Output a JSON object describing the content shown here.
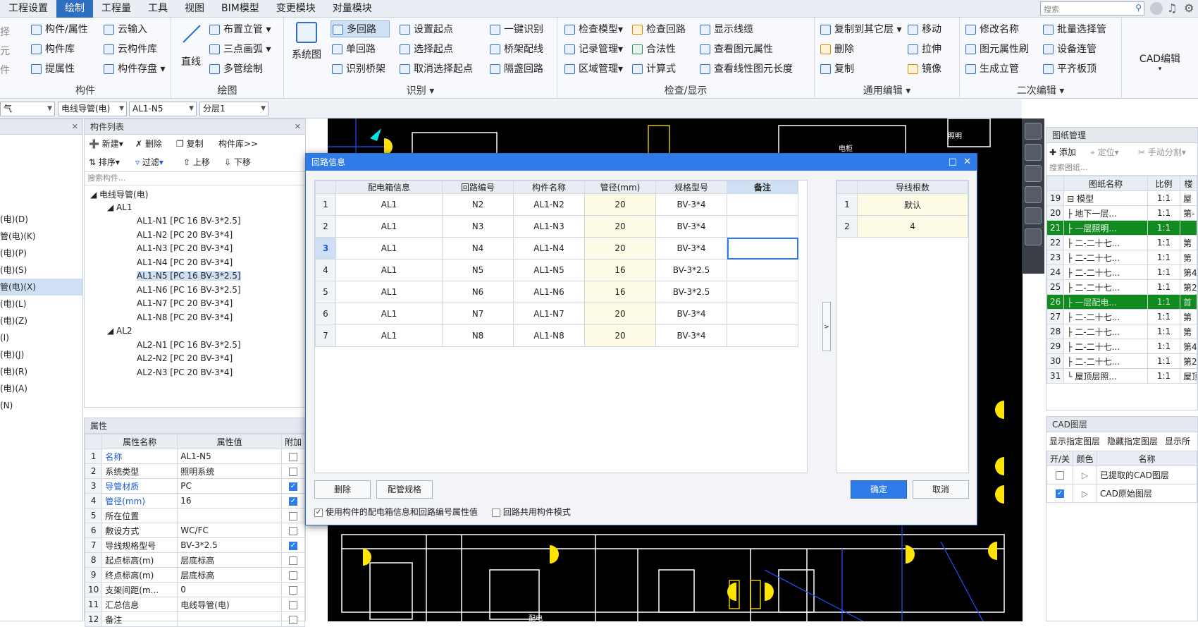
{
  "menu": [
    "工程设置",
    "绘制",
    "工程量",
    "工具",
    "视图",
    "BIM模型",
    "变更模块",
    "对量模块"
  ],
  "menu_active": 1,
  "search_placeholder": "搜索",
  "ribbon": {
    "g1": {
      "b1": "构件/属性",
      "b2": "构件库",
      "b3": "提属性",
      "b4": "云输入",
      "b5": "云构件库",
      "b6": "构件存盘",
      "label": "构件",
      "left_clip": [
        "择",
        "元",
        "件"
      ]
    },
    "g2": {
      "big": "直线",
      "b1": "布置立管",
      "b2": "三点画弧",
      "b3": "多管绘制",
      "label": "绘图"
    },
    "g3": {
      "big": "系统图",
      "b1": "多回路",
      "b2": "单回路",
      "b3": "识别桥架",
      "b4": "设置起点",
      "b5": "选择起点",
      "b6": "取消选择起点",
      "b7": "一键识别",
      "b8": "桥架配线",
      "b9": "隔盏回路",
      "label": "识别"
    },
    "g4": {
      "b1": "检查模型",
      "b2": "记录管理",
      "b3": "区域管理",
      "b4": "检查回路",
      "b5": "合法性",
      "b6": "计算式",
      "b7": "显示线缆",
      "b8": "查看图元属性",
      "b9": "查看线性图元长度",
      "label": "检查/显示"
    },
    "g5": {
      "b1": "复制到其它层",
      "b2": "删除",
      "b3": "复制",
      "b4": "移动",
      "b5": "拉伸",
      "b6": "镜像",
      "label": "通用编辑"
    },
    "g6": {
      "b1": "修改名称",
      "b2": "图元属性刷",
      "b3": "生成立管",
      "b4": "批量选择管",
      "b5": "设备连管",
      "b6": "平齐板顶",
      "label": "二次编辑"
    },
    "g7": {
      "big": "CAD编辑"
    }
  },
  "combos": [
    "气",
    "电线导管(电)",
    "AL1-N5",
    "分层1"
  ],
  "leftClip": [
    "(电)(D)",
    "管(电)(K)",
    "(电)(P)",
    "(电)(S)",
    "管(电)(X)",
    "(电)(L)",
    "(电)(Z)",
    "(I)",
    "(电)(J)",
    "(电)(R)",
    "(电)(A)",
    "(N)"
  ],
  "complist": {
    "title": "构件列表",
    "tb": [
      "新建",
      "删除",
      "复制",
      "构件库>>",
      "排序",
      "过滤",
      "上移",
      "下移"
    ],
    "search": "搜索构件...",
    "root": "电线导管(电)",
    "g1": "AL1",
    "g1items": [
      "AL1-N1 [PC 16 BV-3*2.5]",
      "AL1-N2 [PC 20 BV-3*4]",
      "AL1-N3 [PC 20 BV-3*4]",
      "AL1-N4 [PC 20 BV-3*4]",
      "AL1-N5 [PC 16 BV-3*2.5]",
      "AL1-N6 [PC 16 BV-3*2.5]",
      "AL1-N7 [PC 20 BV-3*4]",
      "AL1-N8 [PC 20 BV-3*4]"
    ],
    "g2": "AL2",
    "g2items": [
      "AL2-N1 [PC 16 BV-3*2.5]",
      "AL2-N2 [PC 20 BV-3*4]",
      "AL2-N3 [PC 20 BV-3*4]"
    ]
  },
  "props": {
    "title": "属性",
    "headers": [
      "属性名称",
      "属性值",
      "附加"
    ],
    "rows": [
      [
        "1",
        "名称",
        "AL1-N5",
        false,
        true
      ],
      [
        "2",
        "系统类型",
        "照明系统",
        false,
        false
      ],
      [
        "3",
        "导管材质",
        "PC",
        true,
        true
      ],
      [
        "4",
        "管径(mm)",
        "16",
        true,
        true
      ],
      [
        "5",
        "所在位置",
        "",
        false,
        false
      ],
      [
        "6",
        "敷设方式",
        "WC/FC",
        false,
        false
      ],
      [
        "7",
        "导线规格型号",
        "BV-3*2.5",
        true,
        false
      ],
      [
        "8",
        "起点标高(m)",
        "层底标高",
        false,
        false
      ],
      [
        "9",
        "终点标高(m)",
        "层底标高",
        false,
        false
      ],
      [
        "10",
        "支架间距(m...",
        "0",
        false,
        false
      ],
      [
        "11",
        "汇总信息",
        "电线导管(电)",
        false,
        false
      ],
      [
        "12",
        "备注",
        "",
        false,
        false
      ]
    ]
  },
  "dialog": {
    "title": "回路信息",
    "headers": [
      "配电箱信息",
      "回路编号",
      "构件名称",
      "管径(mm)",
      "规格型号",
      "备注"
    ],
    "rows": [
      [
        "1",
        "AL1",
        "N2",
        "AL1-N2",
        "20",
        "BV-3*4",
        ""
      ],
      [
        "2",
        "AL1",
        "N3",
        "AL1-N3",
        "20",
        "BV-3*4",
        ""
      ],
      [
        "3",
        "AL1",
        "N4",
        "AL1-N4",
        "20",
        "BV-3*4",
        ""
      ],
      [
        "4",
        "AL1",
        "N5",
        "AL1-N5",
        "16",
        "BV-3*2.5",
        ""
      ],
      [
        "5",
        "AL1",
        "N6",
        "AL1-N6",
        "16",
        "BV-3*2.5",
        ""
      ],
      [
        "6",
        "AL1",
        "N7",
        "AL1-N7",
        "20",
        "BV-3*4",
        ""
      ],
      [
        "7",
        "AL1",
        "N8",
        "AL1-N8",
        "20",
        "BV-3*4",
        ""
      ]
    ],
    "wire_header": "导线根数",
    "wire_rows": [
      [
        "1",
        "默认"
      ],
      [
        "2",
        "4"
      ]
    ],
    "btn_delete": "删除",
    "btn_spec": "配管规格",
    "btn_ok": "确定",
    "btn_cancel": "取消",
    "chk1": "使用构件的配电箱信息和回路编号属性值",
    "chk2": "回路共用构件模式"
  },
  "drawings": {
    "title": "图纸管理",
    "tb": [
      "添加",
      "定位",
      "手动分割"
    ],
    "search": "搜索图纸...",
    "headers": [
      "",
      "图纸名称",
      "比例",
      "楼"
    ],
    "rows": [
      [
        "19",
        "⊟ 模型",
        "1:1",
        "屋",
        "n"
      ],
      [
        "20",
        "├ 地下一层...",
        "1:1",
        "第-",
        "n"
      ],
      [
        "21",
        "├ 一层照明...",
        "1:1",
        "",
        "s"
      ],
      [
        "22",
        "├ 二-二十七...",
        "1:1",
        "第",
        "n"
      ],
      [
        "23",
        "├ 二-二十七...",
        "1:1",
        "第",
        "n"
      ],
      [
        "24",
        "├ 二-二十七...",
        "1:1",
        "第4~",
        "n"
      ],
      [
        "25",
        "├ 二-二十七...",
        "1:1",
        "第2",
        "n"
      ],
      [
        "26",
        "├ 一层配电...",
        "1:1",
        "首",
        "g"
      ],
      [
        "27",
        "├ 二-二十七...",
        "1:1",
        "第",
        "n"
      ],
      [
        "28",
        "├ 二-二十七...",
        "1:1",
        "第",
        "n"
      ],
      [
        "29",
        "├ 二-二十七...",
        "1:1",
        "第4~",
        "n"
      ],
      [
        "30",
        "├ 二-二十七...",
        "1:1",
        "第2",
        "n"
      ],
      [
        "31",
        "└ 屋顶层照...",
        "1:1",
        "屋顶",
        "n"
      ]
    ]
  },
  "cadlayers": {
    "title": "CAD图层",
    "tb": [
      "显示指定图层",
      "隐藏指定图层",
      "显示所"
    ],
    "headers": [
      "开/关",
      "颜色",
      "名称"
    ],
    "rows": [
      [
        "已提取的CAD图层",
        false
      ],
      [
        "CAD原始图层",
        true
      ]
    ]
  },
  "canvas_texts": [
    "照明",
    "配电",
    "电柜"
  ],
  "colors": {
    "accent": "#2f7be8",
    "green_row": "#118a1f",
    "cad_bg": "#000000",
    "cad_yellow": "#ffe400"
  }
}
